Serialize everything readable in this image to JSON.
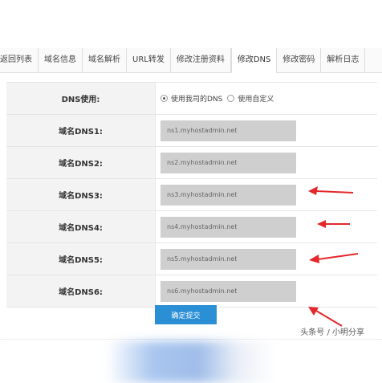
{
  "tabs": [
    {
      "label": "返回列表"
    },
    {
      "label": "域名信息"
    },
    {
      "label": "域名解析"
    },
    {
      "label": "URL转发"
    },
    {
      "label": "修改注册资料"
    },
    {
      "label": "修改DNS",
      "active": true
    },
    {
      "label": "修改密码"
    },
    {
      "label": "解析日志"
    }
  ],
  "form": {
    "dns_usage_label": "DNS使用:",
    "dns_option_mine": "使用我司的DNS",
    "dns_option_custom": "使用自定义",
    "rows": [
      {
        "label": "域名DNS1:",
        "value": "ns1.myhostadmin.net"
      },
      {
        "label": "域名DNS2:",
        "value": "ns2.myhostadmin.net"
      },
      {
        "label": "域名DNS3:",
        "value": "ns3.myhostadmin.net"
      },
      {
        "label": "域名DNS4:",
        "value": "ns4.myhostadmin.net"
      },
      {
        "label": "域名DNS5:",
        "value": "ns5.myhostadmin.net"
      },
      {
        "label": "域名DNS6:",
        "value": "ns6.myhostadmin.net"
      }
    ],
    "submit_label": "确定提交"
  },
  "watermark": "头条号 / 小明分享",
  "colors": {
    "button": "#2b8fd6",
    "arrow": "#e3282b",
    "input_bg": "#cfcfcf"
  }
}
